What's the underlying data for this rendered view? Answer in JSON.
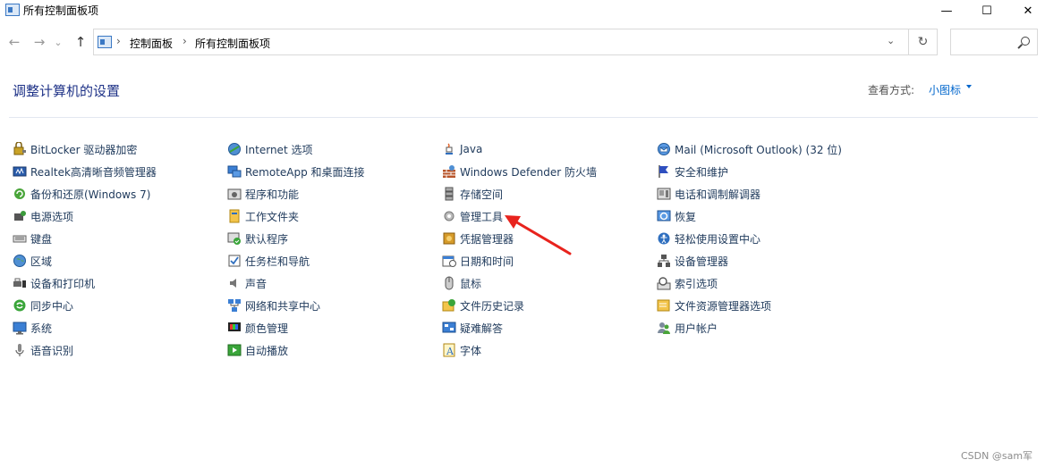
{
  "window": {
    "title": "所有控制面板项",
    "minimize": "—",
    "maximize": "☐",
    "close": "✕"
  },
  "nav": {
    "back": "←",
    "forward": "→",
    "recent": "⌄",
    "up": "↑",
    "breadcrumb": [
      "控制面板",
      "所有控制面板项"
    ],
    "separator": "›",
    "dropdown": "⌄",
    "refresh": "↻",
    "search_placeholder": ""
  },
  "header": {
    "title": "调整计算机的设置",
    "view_by_label": "查看方式:",
    "view_by_value": "小图标"
  },
  "columns": [
    [
      {
        "label": "BitLocker 驱动器加密",
        "icon": "bitlocker-icon"
      },
      {
        "label": "Realtek高清晰音频管理器",
        "icon": "realtek-audio-icon"
      },
      {
        "label": "备份和还原(Windows 7)",
        "icon": "backup-restore-icon"
      },
      {
        "label": "电源选项",
        "icon": "power-options-icon"
      },
      {
        "label": "键盘",
        "icon": "keyboard-icon"
      },
      {
        "label": "区域",
        "icon": "region-icon"
      },
      {
        "label": "设备和打印机",
        "icon": "devices-printers-icon"
      },
      {
        "label": "同步中心",
        "icon": "sync-center-icon"
      },
      {
        "label": "系统",
        "icon": "system-icon"
      },
      {
        "label": "语音识别",
        "icon": "speech-recognition-icon"
      }
    ],
    [
      {
        "label": "Internet 选项",
        "icon": "internet-options-icon"
      },
      {
        "label": "RemoteApp 和桌面连接",
        "icon": "remoteapp-icon"
      },
      {
        "label": "程序和功能",
        "icon": "programs-features-icon"
      },
      {
        "label": "工作文件夹",
        "icon": "work-folders-icon"
      },
      {
        "label": "默认程序",
        "icon": "default-programs-icon"
      },
      {
        "label": "任务栏和导航",
        "icon": "taskbar-navigation-icon"
      },
      {
        "label": "声音",
        "icon": "sound-icon"
      },
      {
        "label": "网络和共享中心",
        "icon": "network-sharing-icon"
      },
      {
        "label": "颜色管理",
        "icon": "color-management-icon"
      },
      {
        "label": "自动播放",
        "icon": "autoplay-icon"
      }
    ],
    [
      {
        "label": "Java",
        "icon": "java-icon"
      },
      {
        "label": "Windows Defender 防火墙",
        "icon": "firewall-icon"
      },
      {
        "label": "存储空间",
        "icon": "storage-spaces-icon"
      },
      {
        "label": "管理工具",
        "icon": "admin-tools-icon"
      },
      {
        "label": "凭据管理器",
        "icon": "credential-manager-icon"
      },
      {
        "label": "日期和时间",
        "icon": "date-time-icon"
      },
      {
        "label": "鼠标",
        "icon": "mouse-icon"
      },
      {
        "label": "文件历史记录",
        "icon": "file-history-icon"
      },
      {
        "label": "疑难解答",
        "icon": "troubleshooting-icon"
      },
      {
        "label": "字体",
        "icon": "fonts-icon"
      }
    ],
    [
      {
        "label": "Mail (Microsoft Outlook) (32 位)",
        "icon": "mail-icon"
      },
      {
        "label": "安全和维护",
        "icon": "security-maintenance-icon"
      },
      {
        "label": "电话和调制解调器",
        "icon": "phone-modem-icon"
      },
      {
        "label": "恢复",
        "icon": "recovery-icon"
      },
      {
        "label": "轻松使用设置中心",
        "icon": "ease-of-access-icon"
      },
      {
        "label": "设备管理器",
        "icon": "device-manager-icon"
      },
      {
        "label": "索引选项",
        "icon": "indexing-options-icon"
      },
      {
        "label": "文件资源管理器选项",
        "icon": "file-explorer-options-icon"
      },
      {
        "label": "用户帐户",
        "icon": "user-accounts-icon"
      }
    ]
  ],
  "annotation": {
    "type": "red-arrow",
    "points_to": "管理工具",
    "color": "#e8231d"
  },
  "watermark": "CSDN @sam军",
  "colors": {
    "link": "#1e395b",
    "heading": "#1e3287",
    "viewby": "#0066cc"
  }
}
